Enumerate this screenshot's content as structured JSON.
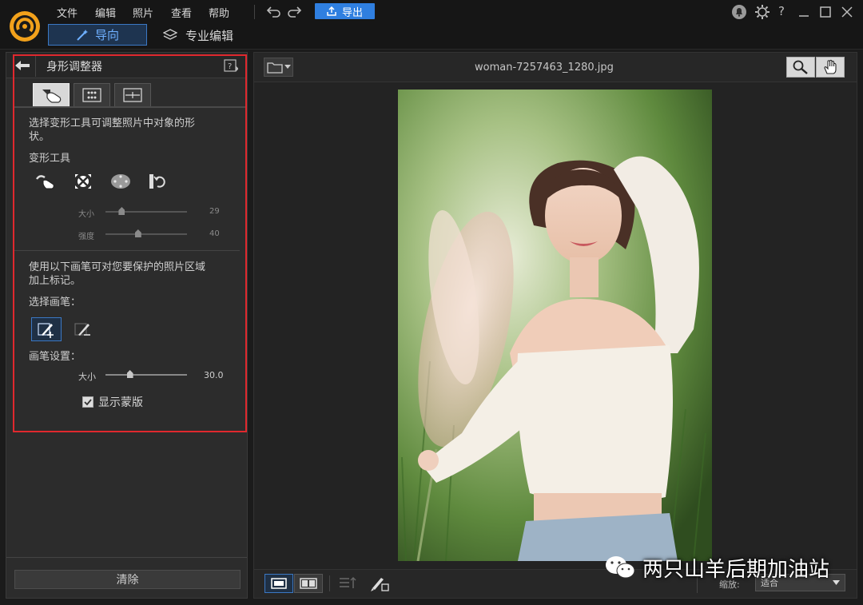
{
  "menu": {
    "file": "文件",
    "edit": "编辑",
    "photo": "照片",
    "view": "查看",
    "help": "帮助",
    "export": "导出"
  },
  "modes": {
    "guide": "导向",
    "pro": "专业编辑"
  },
  "panel": {
    "title": "身形调整器",
    "desc1": "选择变形工具可调整照片中对象的形",
    "desc1b": "状。",
    "warpTools": "变形工具",
    "size_label": "大小",
    "size_value": "29",
    "size_level": 0.2,
    "strength_label": "强度",
    "strength_value": "40",
    "strength_level": 0.4,
    "desc2": "使用以下画笔可对您要保护的照片区域",
    "desc2b": "加上标记。",
    "selectBrush": "选择画笔：",
    "brushSettings": "画笔设置：",
    "brush_size_label": "大小",
    "brush_size_value": "30.0",
    "brush_size_level": 0.3,
    "showMask": "显示蒙版",
    "clear": "清除"
  },
  "viewer": {
    "filename": "woman-7257463_1280.jpg",
    "zoom_label": "缩放:",
    "zoom_value": "适合"
  },
  "watermark": "两只山羊后期加油站",
  "colors": {
    "accent": "#2f7fe0",
    "highlight": "#e0282e"
  }
}
